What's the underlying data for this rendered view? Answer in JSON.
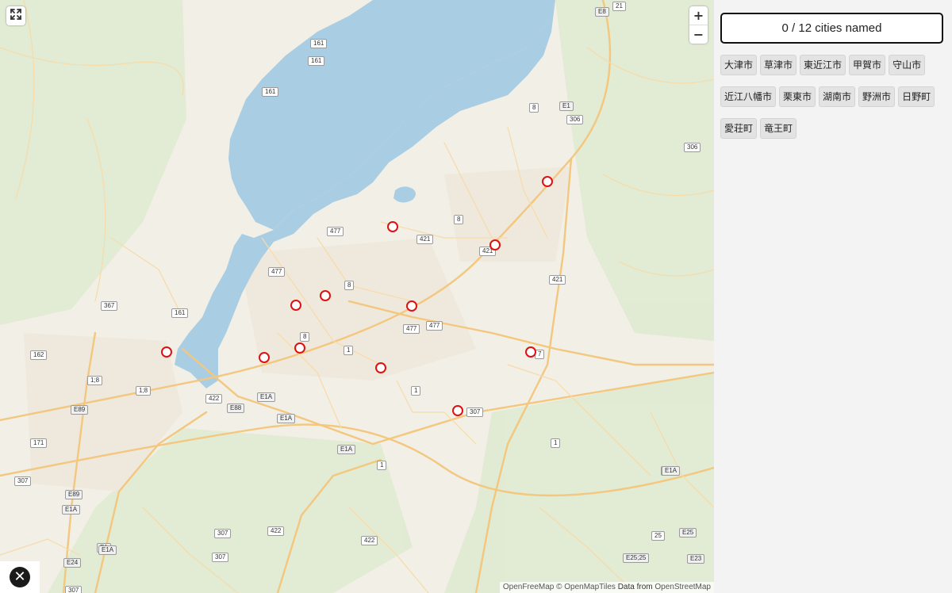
{
  "counter": {
    "named": 0,
    "total": 12,
    "text": "0 / 12 cities named"
  },
  "cities": [
    "大津市",
    "草津市",
    "東近江市",
    "甲賀市",
    "守山市",
    "近江八幡市",
    "栗東市",
    "湖南市",
    "野洲市",
    "日野町",
    "愛荘町",
    "竜王町"
  ],
  "controls": {
    "zoom_in": "+",
    "zoom_out": "−",
    "fullscreen_icon": "expand-arrows-icon",
    "close_icon": "close-circle-icon",
    "close_symbol": "✕"
  },
  "attribution": {
    "part1": "OpenFreeMap © OpenMapTiles",
    "part2": "Data from",
    "part3": "OpenStreetMap"
  },
  "road_labels": [
    "21",
    "E8",
    "161",
    "161",
    "161",
    "8",
    "E1",
    "306",
    "306",
    "8",
    "477",
    "421",
    "421",
    "477",
    "8",
    "477",
    "421",
    "367",
    "161",
    "8",
    "477",
    "477",
    "1",
    "7",
    "162",
    "1;8",
    "1;8",
    "1",
    "E1A",
    "E88",
    "422",
    "E1A",
    "1",
    "307",
    "E89",
    "E1A",
    "171",
    "307",
    "1",
    "E1",
    "E1A",
    "E89",
    "1",
    "307",
    "422",
    "422",
    "307",
    "E1A",
    "25",
    "E25",
    "E25;25",
    "E23",
    "E24",
    "307",
    "E1A"
  ],
  "colors": {
    "water": "#a9cde2",
    "land": "#f4f1e8",
    "marker": "#dd1111",
    "road": "#f6cf8f"
  }
}
